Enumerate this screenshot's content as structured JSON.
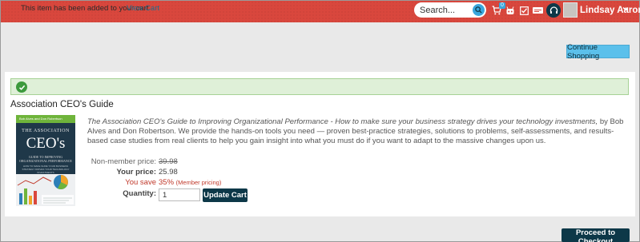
{
  "header": {
    "search": {
      "placeholder": "Search..."
    },
    "cart_count": "0",
    "user_name": "Lindsay Aaron",
    "icons": [
      "search-icon",
      "cart-icon",
      "robot-icon",
      "checklist-icon",
      "news-icon",
      "headset-icon",
      "avatar",
      "chevron-down-icon"
    ]
  },
  "toolbar": {
    "continue_label": "Continue Shopping"
  },
  "alert": {
    "message": "This item has been added to your cart",
    "link_label": "View Cart"
  },
  "product": {
    "title": "Association CEO's Guide",
    "description_italic": "The Association CEO's Guide to Improving Organizational Performance - How to make sure your business strategy drives your technology investments,",
    "description_rest": " by Bob Alves and Don Robertson. We provide the hands-on tools you need — proven best-practice strategies, solutions to problems, self-assessments, and results-based case studies from real clients to help you gain insight into what you must do if you want to adapt to the massive changes upon us.",
    "cover": {
      "authors": "Bob Alves and Don Robertson",
      "line1": "THE ASSOCIATION",
      "line2": "CEO's",
      "line3": "GUIDE TO IMPROVING ORGANIZATIONAL PERFORMANCE",
      "line4": "HOW TO MAKE SURE YOUR BUSINESS STRATEGY DRIVES YOUR TECHNOLOGY INVESTMENTS"
    },
    "non_member_label": "Non-member price:",
    "non_member_price": "39.98",
    "your_price_label": "Your price:",
    "your_price": "25.98",
    "save_label": "You save",
    "save_percent": "35%",
    "save_note": "(Member pricing)",
    "quantity_label": "Quantity:",
    "quantity_value": "1",
    "update_label": "Update Cart"
  },
  "footer": {
    "checkout_label": "Proceed to Checkout"
  },
  "colors": {
    "header_red": "#d9473d",
    "accent_blue": "#39a6dc",
    "dark_button": "#0d3848",
    "success_bg": "#dff0d8",
    "save_red": "#c0392b"
  }
}
